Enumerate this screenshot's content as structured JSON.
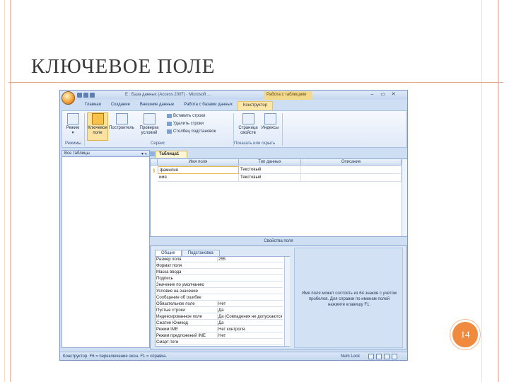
{
  "slide": {
    "title": "КЛЮЧЕВОЕ ПОЛЕ",
    "page_number": "14",
    "accent_color": "#f08a3e"
  },
  "window": {
    "title": "Е : База данных (Access 2007) - Microsoft ...",
    "context_title": "Работа с таблицами",
    "controls": [
      "–",
      "▭",
      "✕"
    ],
    "tabs": [
      "Главная",
      "Создание",
      "Внешние данные",
      "Работа с базами данных",
      "Конструктор"
    ]
  },
  "ribbon": {
    "view_label": "Режим",
    "key_label": "Ключевое поле",
    "builder_label": "Построитель",
    "test_label": "Проверка условий",
    "insert_rows": "Вставить строки",
    "delete_rows": "Удалить строки",
    "lookup_column": "Столбец подстановок",
    "property_sheet": "Страница свойств",
    "indexes": "Индексы",
    "groups": {
      "views": "Режимы",
      "tools": "Сервис",
      "show_hide": "Показать или скрыть"
    }
  },
  "nav_pane": {
    "title": "Все таблицы"
  },
  "document_tab": {
    "label": "Таблица1"
  },
  "design_grid": {
    "columns": [
      "Имя поля",
      "Тип данных",
      "Описание"
    ],
    "rows": [
      {
        "field": "фамилия",
        "type": "Текстовый",
        "description": ""
      },
      {
        "field": "имя",
        "type": "Текстовый",
        "description": ""
      }
    ]
  },
  "field_properties": {
    "bar_label": "Свойства поля",
    "tabs": [
      "Общие",
      "Подстановка"
    ],
    "rows": [
      {
        "label": "Размер поля",
        "value": "255"
      },
      {
        "label": "Формат поля",
        "value": ""
      },
      {
        "label": "Маска ввода",
        "value": ""
      },
      {
        "label": "Подпись",
        "value": ""
      },
      {
        "label": "Значение по умолчанию",
        "value": ""
      },
      {
        "label": "Условие на значение",
        "value": ""
      },
      {
        "label": "Сообщение об ошибке",
        "value": ""
      },
      {
        "label": "Обязательное поле",
        "value": "Нет"
      },
      {
        "label": "Пустые строки",
        "value": "Да"
      },
      {
        "label": "Индексированное поле",
        "value": "Да (Совпадения не допускаются)"
      },
      {
        "label": "Сжатие Юникод",
        "value": "Да"
      },
      {
        "label": "Режим IME",
        "value": "Нет контроля"
      },
      {
        "label": "Режим предложений IME",
        "value": "Нет"
      },
      {
        "label": "Смарт-теги",
        "value": ""
      }
    ],
    "help_text": "Имя поля может состоять из 64 знаков с учетом пробелов. Для справки по именам полей нажмите клавишу F1."
  },
  "status_bar": {
    "left": "Конструктор. F6 = переключение окон. F1 = справка.",
    "num_lock": "Num Lock"
  }
}
